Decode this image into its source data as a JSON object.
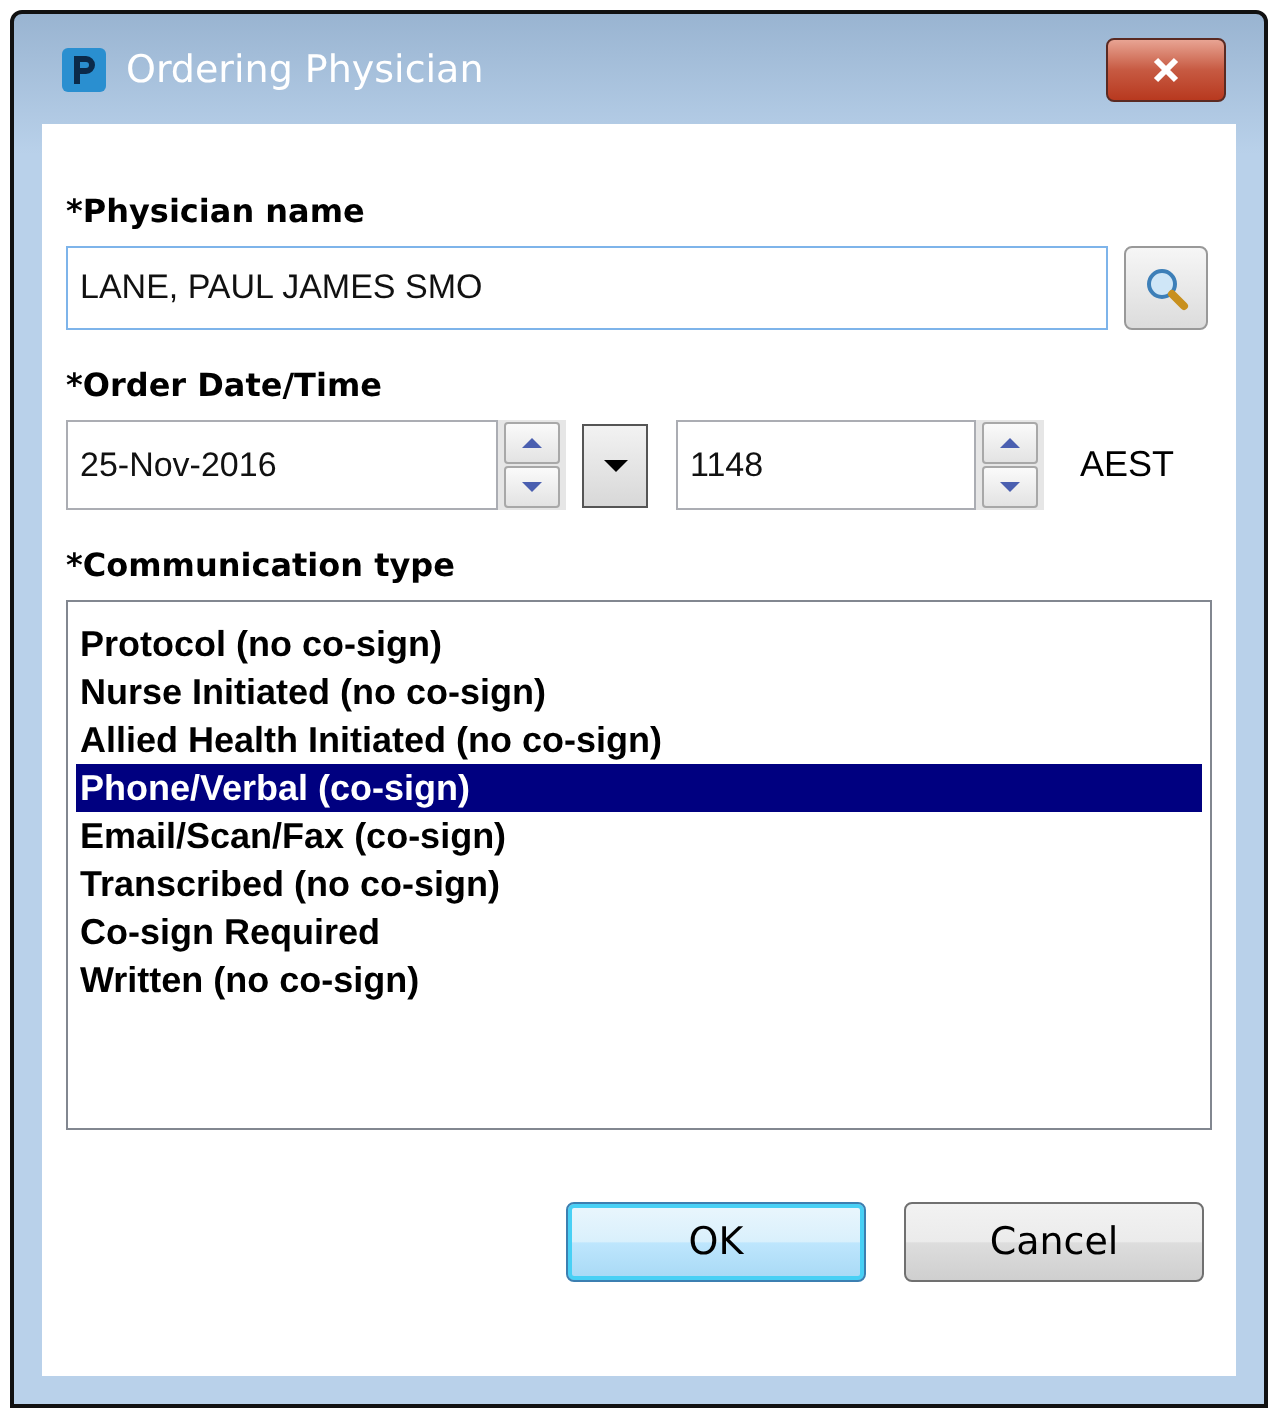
{
  "window": {
    "title": "Ordering Physician"
  },
  "physician": {
    "label": "*Physician name",
    "value": "LANE, PAUL JAMES SMO"
  },
  "order": {
    "label": "*Order Date/Time",
    "date": "25-Nov-2016",
    "time": "1148",
    "timezone": "AEST"
  },
  "communication": {
    "label": "*Communication type",
    "items": [
      {
        "label": "Protocol (no co-sign)",
        "selected": false
      },
      {
        "label": "Nurse Initiated (no co-sign)",
        "selected": false
      },
      {
        "label": "Allied Health Initiated (no co-sign)",
        "selected": false
      },
      {
        "label": "Phone/Verbal (co-sign)",
        "selected": true
      },
      {
        "label": "Email/Scan/Fax (co-sign)",
        "selected": false
      },
      {
        "label": "Transcribed (no co-sign)",
        "selected": false
      },
      {
        "label": "Co-sign Required",
        "selected": false
      },
      {
        "label": "Written (no co-sign)",
        "selected": false
      }
    ]
  },
  "buttons": [
    {
      "label": "OK",
      "kind": "default"
    },
    {
      "label": "Cancel",
      "kind": "normal"
    }
  ]
}
